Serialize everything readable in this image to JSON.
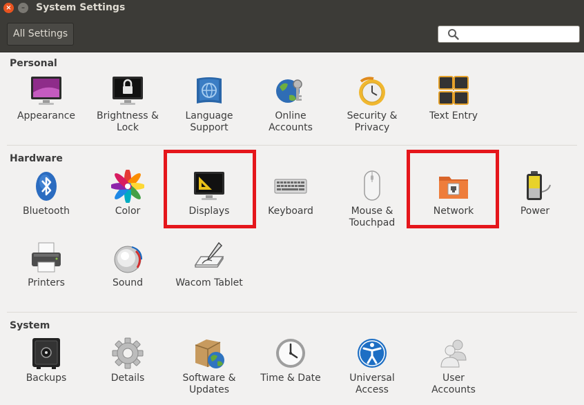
{
  "window": {
    "title": "System Settings",
    "close_glyph": "×",
    "minimize_glyph": "–"
  },
  "toolbar": {
    "all_settings_label": "All Settings",
    "search_placeholder": ""
  },
  "sections": {
    "personal": {
      "title": "Personal",
      "items": [
        {
          "label": "Appearance",
          "icon": "appearance-icon"
        },
        {
          "label": "Brightness &\nLock",
          "icon": "brightness-lock-icon"
        },
        {
          "label": "Language\nSupport",
          "icon": "language-support-icon"
        },
        {
          "label": "Online\nAccounts",
          "icon": "online-accounts-icon"
        },
        {
          "label": "Security &\nPrivacy",
          "icon": "security-privacy-icon"
        },
        {
          "label": "Text Entry",
          "icon": "text-entry-icon"
        }
      ]
    },
    "hardware": {
      "title": "Hardware",
      "items": [
        {
          "label": "Bluetooth",
          "icon": "bluetooth-icon"
        },
        {
          "label": "Color",
          "icon": "color-icon"
        },
        {
          "label": "Displays",
          "icon": "displays-icon"
        },
        {
          "label": "Keyboard",
          "icon": "keyboard-icon"
        },
        {
          "label": "Mouse &\nTouchpad",
          "icon": "mouse-touchpad-icon"
        },
        {
          "label": "Network",
          "icon": "network-icon"
        },
        {
          "label": "Power",
          "icon": "power-icon"
        },
        {
          "label": "Printers",
          "icon": "printer-icon"
        },
        {
          "label": "Sound",
          "icon": "sound-icon"
        },
        {
          "label": "Wacom Tablet",
          "icon": "wacom-tablet-icon"
        }
      ]
    },
    "system": {
      "title": "System",
      "items": [
        {
          "label": "Backups",
          "icon": "backups-icon"
        },
        {
          "label": "Details",
          "icon": "details-icon"
        },
        {
          "label": "Software &\nUpdates",
          "icon": "software-updates-icon"
        },
        {
          "label": "Time & Date",
          "icon": "time-date-icon"
        },
        {
          "label": "Universal\nAccess",
          "icon": "universal-access-icon"
        },
        {
          "label": "User\nAccounts",
          "icon": "user-accounts-icon"
        }
      ]
    }
  },
  "colors": {
    "highlight": "#e5161b",
    "titlebar": "#3c3b37",
    "accent": "#e95420"
  }
}
